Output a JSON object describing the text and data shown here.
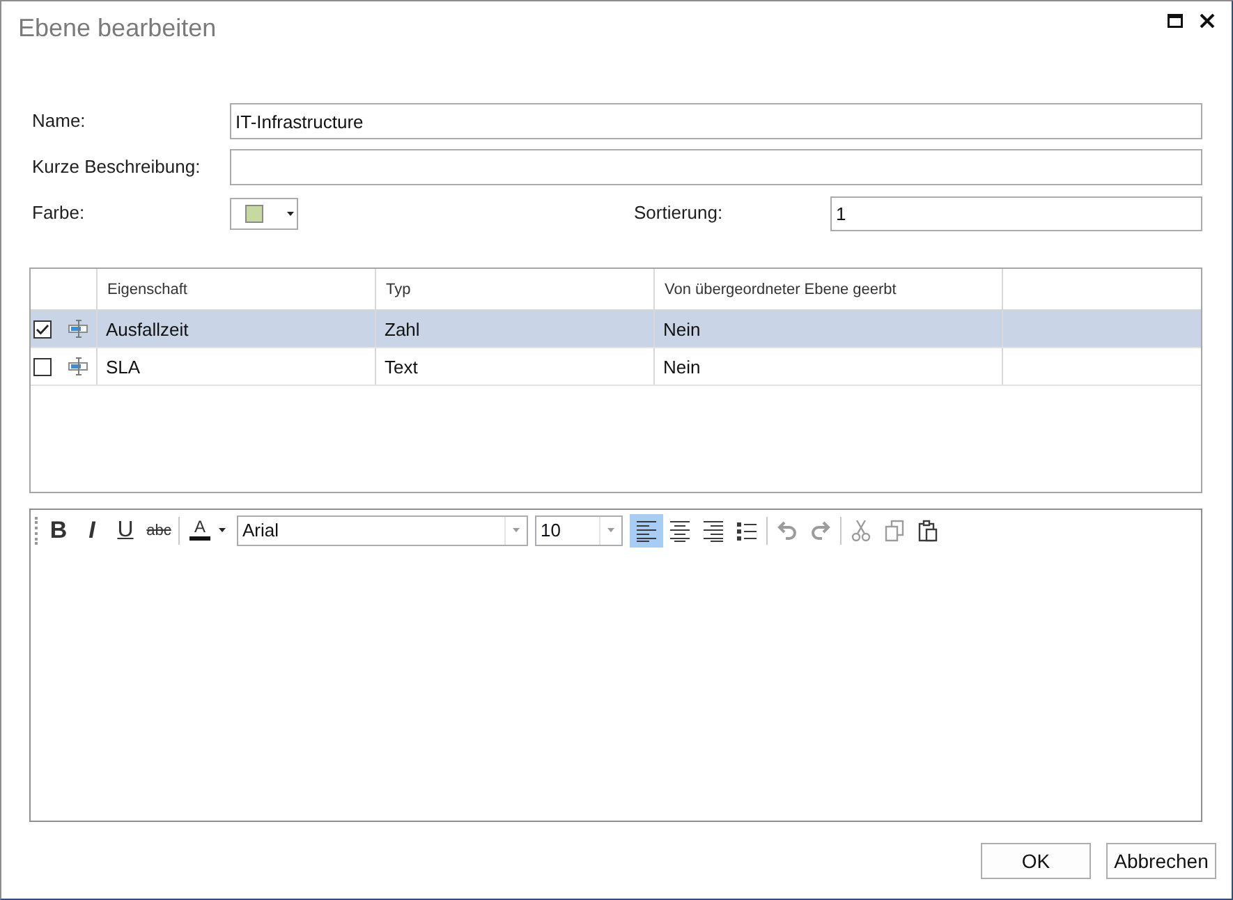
{
  "window": {
    "title": "Ebene bearbeiten"
  },
  "form": {
    "name": {
      "label": "Name:",
      "value": "IT-Infrastructure"
    },
    "description": {
      "label": "Kurze Beschreibung:"
    },
    "color": {
      "label": "Farbe:",
      "color": "#c5d9a0"
    },
    "sorting": {
      "label": "Sortierung:",
      "value": "1"
    }
  },
  "table": {
    "columns": [
      {
        "label": "Eigenschaft"
      },
      {
        "label": "Typ"
      },
      {
        "label": "Von übergeordneter Ebene geerbt"
      }
    ],
    "rows": [
      {
        "checked": true,
        "selected": true,
        "cells": [
          "Ausfallzeit",
          "Zahl",
          "Nein"
        ]
      },
      {
        "checked": false,
        "selected": false,
        "cells": [
          "SLA",
          "Text",
          "Nein"
        ]
      }
    ]
  },
  "editor": {
    "toolbar": [
      {
        "kind": "bold",
        "label": "B",
        "on": false
      },
      {
        "kind": "italic",
        "label": "I",
        "on": false
      },
      {
        "kind": "underline",
        "label": "U",
        "on": false
      },
      {
        "kind": "strike",
        "label": "abc",
        "on": false
      },
      {
        "kind": "separator"
      },
      {
        "kind": "font_color",
        "label": "A"
      },
      {
        "kind": "font_family",
        "value": "Arial"
      },
      {
        "kind": "font_size",
        "value": "10"
      },
      {
        "kind": "align_left",
        "on": true
      },
      {
        "kind": "align_center",
        "on": false
      },
      {
        "kind": "align_right",
        "on": false
      },
      {
        "kind": "bullets",
        "on": false
      },
      {
        "kind": "separator"
      },
      {
        "kind": "undo",
        "disabled": true
      },
      {
        "kind": "redo",
        "disabled": true
      },
      {
        "kind": "separator"
      },
      {
        "kind": "cut",
        "disabled": true
      },
      {
        "kind": "copy",
        "disabled": true
      },
      {
        "kind": "paste",
        "disabled": false
      }
    ]
  },
  "buttons": [
    {
      "label": "OK"
    },
    {
      "label": "Abbrechen"
    }
  ]
}
